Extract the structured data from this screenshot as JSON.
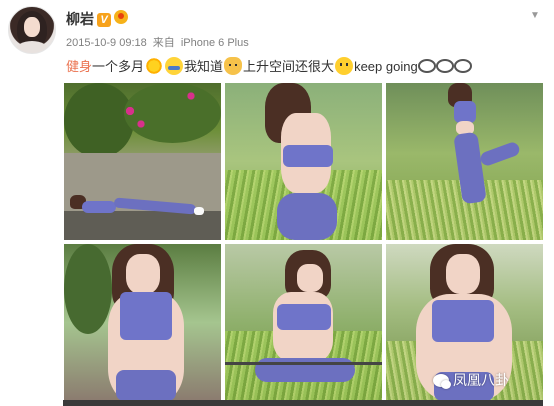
{
  "user": {
    "name": "柳岩",
    "verified_badge": "V"
  },
  "meta": {
    "timestamp": "2015-10-9 09:18",
    "source_prefix": "来自",
    "source_device": "iPhone 6 Plus"
  },
  "post": {
    "hashtag": "健身",
    "segments": [
      "一个多月",
      "我知道",
      "上升空间还很大",
      "keep going"
    ],
    "emoticons": [
      "sun-emoticon",
      "shy-emoticon",
      "cat-emoticon",
      "happy-emoticon",
      "bicycle-emoticon"
    ]
  },
  "photos": [
    {
      "name": "photo-plank-pose"
    },
    {
      "name": "photo-standing-back"
    },
    {
      "name": "photo-stretching-pose"
    },
    {
      "name": "photo-front-portrait"
    },
    {
      "name": "photo-side-pose"
    },
    {
      "name": "photo-smiling-portrait"
    }
  ],
  "watermark": {
    "text": "凤凰八卦"
  },
  "colors": {
    "hashtag": "#eb7350",
    "meta_gray": "#808080",
    "text": "#333333",
    "verified": "#f7a21b"
  }
}
